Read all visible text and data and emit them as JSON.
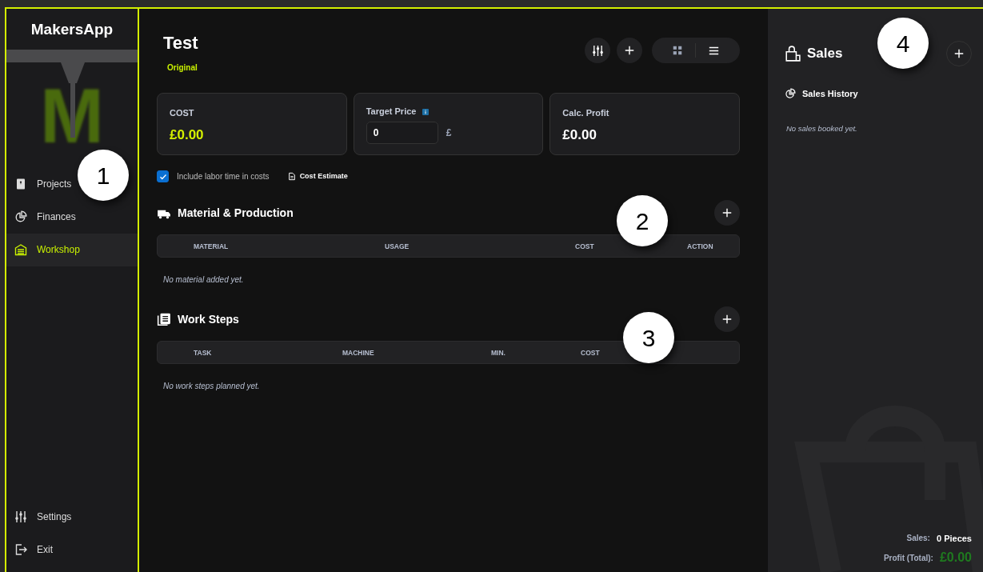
{
  "sidebar": {
    "app_title": "MakersApp",
    "logo_letter": "M",
    "items": [
      {
        "label": "Projects",
        "kind": "book",
        "selected": false
      },
      {
        "label": "Finances",
        "kind": "pie",
        "selected": false
      },
      {
        "label": "Workshop",
        "kind": "garage",
        "selected": true
      }
    ],
    "bottom_items": [
      {
        "label": "Settings",
        "kind": "sliders"
      },
      {
        "label": "Exit",
        "kind": "exit"
      }
    ]
  },
  "project": {
    "title": "Test",
    "subtitle": "Original"
  },
  "summary": {
    "cost": {
      "label": "COST",
      "value": "£0.00"
    },
    "target": {
      "label": "Target Price",
      "value": "0",
      "currency": "£"
    },
    "profit": {
      "label": "Calc. Profit",
      "value": "£0.00"
    }
  },
  "labor_checkbox": {
    "label": "Include labor time in costs",
    "checked": true
  },
  "cost_estimate_link": "Cost Estimate",
  "sections": [
    {
      "title": "Material & Production",
      "kind": "truck",
      "columns": [
        "MATERIAL",
        "USAGE",
        "COST",
        "ACTION"
      ],
      "empty_text": "No material added yet."
    },
    {
      "title": "Work Steps",
      "kind": "clipboard",
      "columns": [
        "TASK",
        "MACHINE",
        "MIN.",
        "COST"
      ],
      "empty_text": "No work steps planned yet."
    }
  ],
  "sales": {
    "title": "Sales",
    "history_title": "Sales History",
    "empty_text": "No sales booked yet.",
    "sales_label": "Sales:",
    "sales_value": "0 Pieces",
    "profit_label": "Profit (Total):",
    "profit_value": "£0.00"
  },
  "callouts": [
    {
      "number": "1"
    },
    {
      "number": "2"
    },
    {
      "number": "3"
    },
    {
      "number": "4"
    }
  ]
}
